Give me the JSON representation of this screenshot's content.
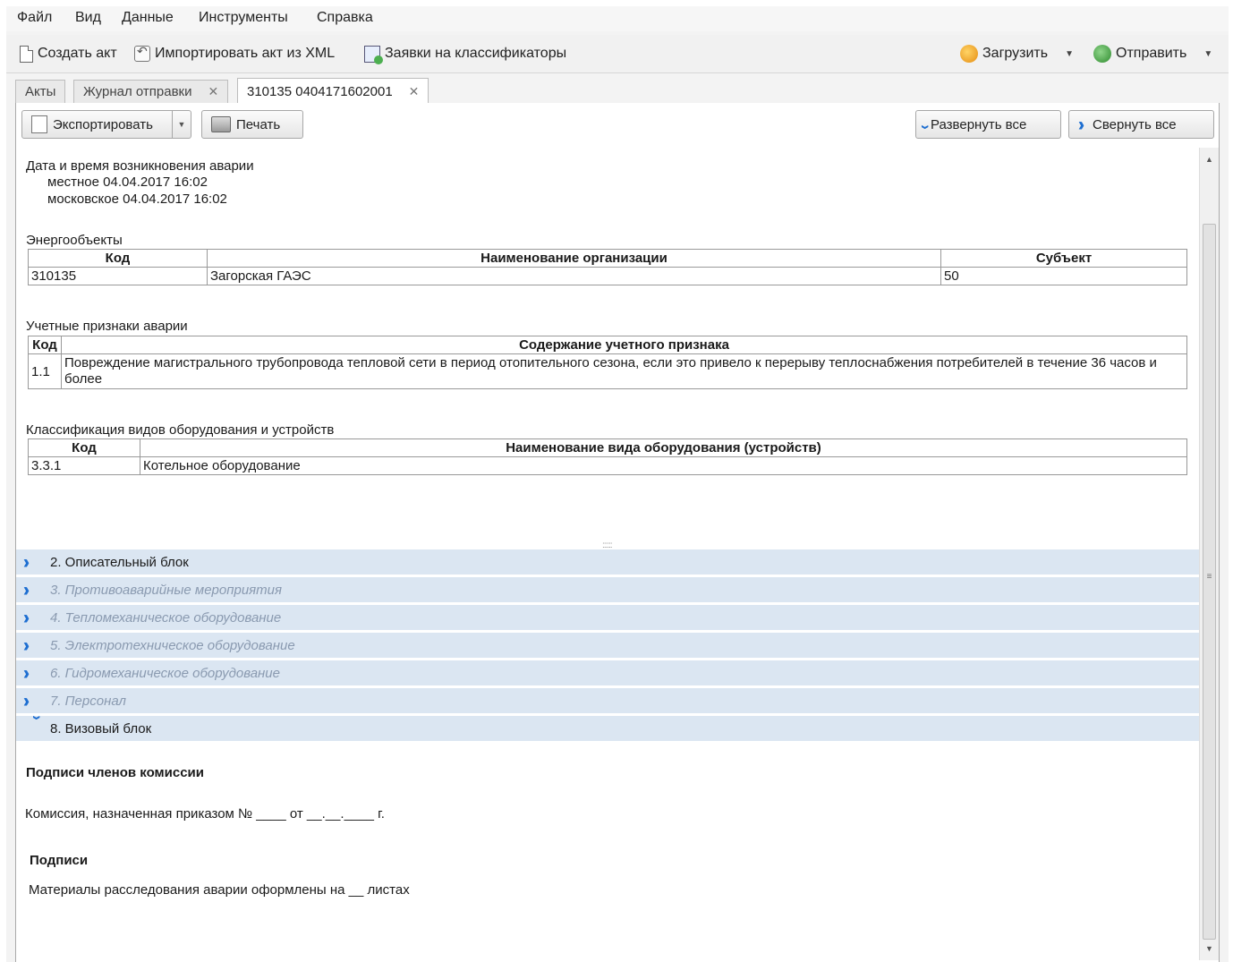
{
  "menu": [
    "Файл",
    "Вид",
    "Данные",
    "Инструменты",
    "Справка"
  ],
  "toolbar": {
    "create": "Создать акт",
    "import": "Импортировать акт из XML",
    "claims": "Заявки на классификаторы",
    "load": "Загрузить",
    "send": "Отправить"
  },
  "tabs": {
    "acts": "Акты",
    "journal": "Журнал отправки",
    "doc": "310135 0404171602001"
  },
  "panel_toolbar": {
    "export": "Экспортировать",
    "print": "Печать",
    "expand_all": "Развернуть все",
    "collapse_all": "Свернуть все"
  },
  "content": {
    "datetime_title": "Дата и время возникновения аварии",
    "local": "местное 04.04.2017 16:02",
    "moscow": "московское 04.04.2017 16:02",
    "energy": {
      "title": "Энергообъекты",
      "headers": [
        "Код",
        "Наименование организации",
        "Субъект"
      ],
      "row": [
        "310135",
        "Загорская ГАЭС",
        "50"
      ]
    },
    "signs": {
      "title": "Учетные признаки аварии",
      "headers": [
        "Код",
        "Содержание учетного признака"
      ],
      "row": [
        "1.1",
        "Повреждение магистрального трубопровода тепловой сети в период отопительного сезона, если это привело к перерыву теплоснабжения потребителей в течение 36 часов и более"
      ]
    },
    "equip": {
      "title": "Классификация видов оборудования и устройств",
      "headers": [
        "Код",
        "Наименование вида оборудования (устройств)"
      ],
      "row": [
        "3.3.1",
        "Котельное оборудование"
      ]
    }
  },
  "sections": [
    "2. Описательный блок",
    "3. Противоаварийные мероприятия",
    "4. Тепломеханическое оборудование",
    "5. Электротехническое оборудование",
    "6. Гидромеханическое оборудование",
    "7. Персонал",
    "8. Визовый блок"
  ],
  "visa": {
    "members_title": "Подписи членов комиссии",
    "commission": "Комиссия, назначенная приказом № ____ от __.__.____ г.",
    "signs_title": "Подписи",
    "materials": "Материалы расследования аварии оформлены на __ листах"
  }
}
